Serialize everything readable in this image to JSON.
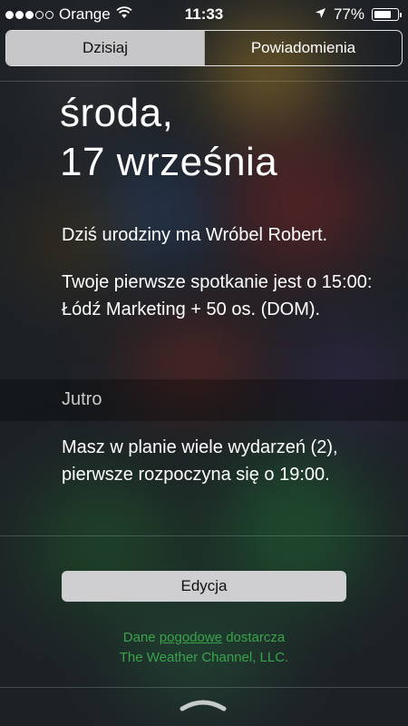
{
  "status_bar": {
    "signal_dots": [
      true,
      true,
      true,
      false,
      false
    ],
    "carrier": "Orange",
    "time": "11:33",
    "battery": "77%",
    "battery_level": 0.77,
    "icons": [
      "wifi-icon",
      "location-arrow-icon",
      "battery-icon"
    ]
  },
  "tabs": [
    {
      "label": "Dzisiaj",
      "active": true
    },
    {
      "label": "Powiadomienia",
      "active": false
    }
  ],
  "today": {
    "day": "środa,",
    "date": "17 września",
    "birthday": "Dziś urodziny ma Wróbel Robert.",
    "meeting": "Twoje pierwsze spotkanie jest o 15:00: Łódź Marketing + 50 os. (DOM)."
  },
  "tomorrow": {
    "title": "Jutro",
    "summary": "Masz w planie wiele wydarzeń (2), pierwsze rozpoczyna się o 19:00."
  },
  "edit_label": "Edycja",
  "credits": {
    "prefix": "Dane ",
    "link": "pogodowe",
    "suffix": " dostarcza",
    "provider": "The Weather Channel, LLC."
  },
  "colors": {
    "accent_green": "#3aa34a",
    "segment_active": "#c7c7c9",
    "button": "#cfcfd1"
  }
}
